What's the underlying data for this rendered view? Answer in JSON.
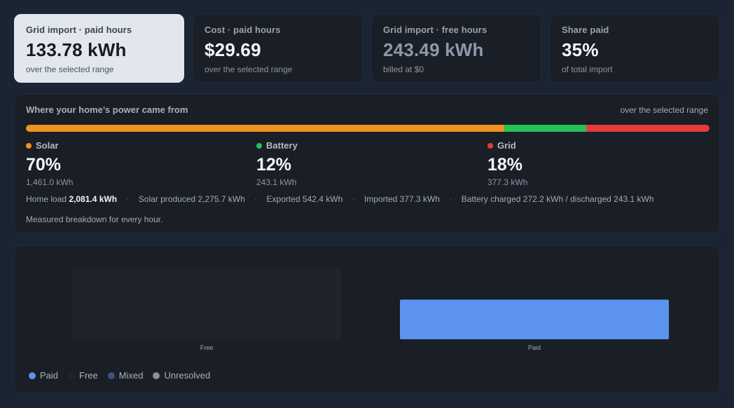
{
  "cards": [
    {
      "label": "Grid import · paid hours",
      "value": "133.78 kWh",
      "sub": "over the selected range"
    },
    {
      "label": "Cost · paid hours",
      "value": "$29.69",
      "sub": "over the selected range"
    },
    {
      "label": "Grid import · free hours",
      "value": "243.49 kWh",
      "sub": "billed at $0"
    },
    {
      "label": "Share paid",
      "value": "35%",
      "sub": "of total import"
    }
  ],
  "sources": {
    "title": "Where your home’s power came from",
    "range": "over the selected range",
    "mix": [
      {
        "name": "Solar",
        "share": 70,
        "color": "#f0921f"
      },
      {
        "name": "Battery",
        "share": 12,
        "color": "#27c15a"
      },
      {
        "name": "Grid",
        "share": 18,
        "color": "#e53b3b"
      }
    ],
    "items": [
      {
        "name": "Solar",
        "pct": "70%",
        "kwh": "1,461.0 kWh",
        "color": "#f0921f"
      },
      {
        "name": "Battery",
        "pct": "12%",
        "kwh": "243.1 kWh",
        "color": "#27c15a"
      },
      {
        "name": "Grid",
        "pct": "18%",
        "kwh": "377.3 kWh",
        "color": "#e53b3b"
      }
    ],
    "stats": {
      "home_load_label": "Home load",
      "home_load_value": "2,081.4 kWh",
      "solar": "Solar produced 2,275.7 kWh",
      "exported": "Exported 542.4 kWh",
      "imported": "Imported 377.3 kWh",
      "battery": "Battery charged 272.2 kWh / discharged 243.1 kWh",
      "separator": "·"
    },
    "note": "Measured breakdown for every hour."
  },
  "chart_data": {
    "type": "bar",
    "categories": [
      "Free",
      "Paid"
    ],
    "values": [
      243.49,
      133.78
    ],
    "colors": [
      "#1f232c",
      "#5b93ee"
    ],
    "grid": false,
    "legend_position": "bottom-left",
    "legend": [
      {
        "name": "Paid",
        "color": "#5b93ee"
      },
      {
        "name": "Free",
        "color": "#1f232c"
      },
      {
        "name": "Mixed",
        "color": "#3b5578"
      },
      {
        "name": "Unresolved",
        "color": "#8b9099"
      }
    ]
  }
}
